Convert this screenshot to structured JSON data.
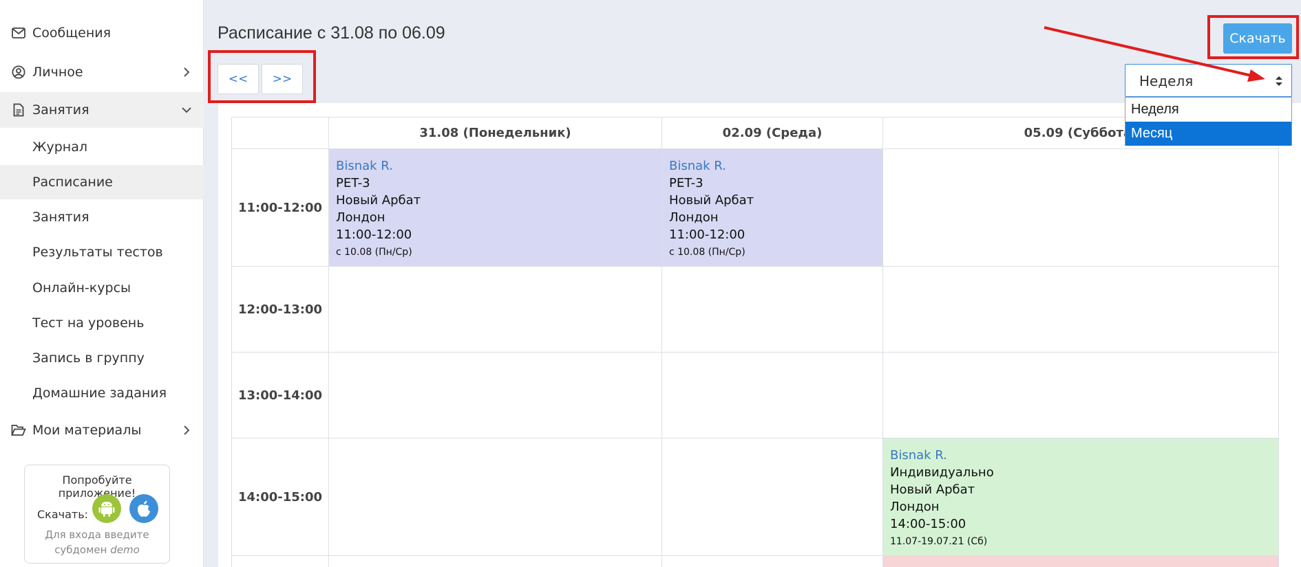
{
  "sidebar": {
    "items": [
      {
        "label": "Сообщения",
        "icon": "envelope-icon"
      },
      {
        "label": "Личное",
        "icon": "user-circle-icon"
      },
      {
        "label": "Занятия",
        "icon": "document-icon"
      }
    ],
    "sub_items": [
      "Журнал",
      "Расписание",
      "Занятия",
      "Результаты тестов",
      "Онлайн-курсы",
      "Тест на уровень",
      "Запись в группу",
      "Домашние задания"
    ],
    "materials_label": "Мои материалы",
    "promo": {
      "title": "Попробуйте приложение!",
      "download_label": "Скачать:",
      "hint_prefix": "Для входа введите",
      "hint_line2": "субдомен",
      "hint_domain": "demo"
    }
  },
  "header": {
    "title": "Расписание с 31.08 по 06.09",
    "prev_label": "<<",
    "next_label": ">>",
    "download_label": "Скачать",
    "period_select": {
      "value": "Неделя",
      "options": [
        "Неделя",
        "Месяц"
      ],
      "highlighted": "Месяц"
    }
  },
  "schedule": {
    "columns": [
      "31.08 (Понедельник)",
      "02.09 (Среда)",
      "05.09 (Суббота)"
    ],
    "times": [
      "11:00-12:00",
      "12:00-13:00",
      "13:00-14:00",
      "14:00-15:00"
    ],
    "events": {
      "mon_11": {
        "who": "Bisnak R.",
        "group": "PET-3",
        "place": "Новый Арбат",
        "room": "Лондон",
        "time": "11:00-12:00",
        "note": "с 10.08 (Пн/Ср)"
      },
      "wed_11": {
        "who": "Bisnak R.",
        "group": "PET-3",
        "place": "Новый Арбат",
        "room": "Лондон",
        "time": "11:00-12:00",
        "note": "с 10.08 (Пн/Ср)"
      },
      "sat_14": {
        "who": "Bisnak R.",
        "group": "Индивидуально",
        "place": "Новый Арбат",
        "room": "Лондон",
        "time": "14:00-15:00",
        "note": "11.07-19.07.21 (Сб)"
      }
    }
  },
  "colors": {
    "accent": "#4aa6e8",
    "event_purple": "#d7d8f3",
    "event_green": "#d5f3d4",
    "event_pink": "#f7d4d6",
    "annotation_red": "#e11d1d"
  }
}
